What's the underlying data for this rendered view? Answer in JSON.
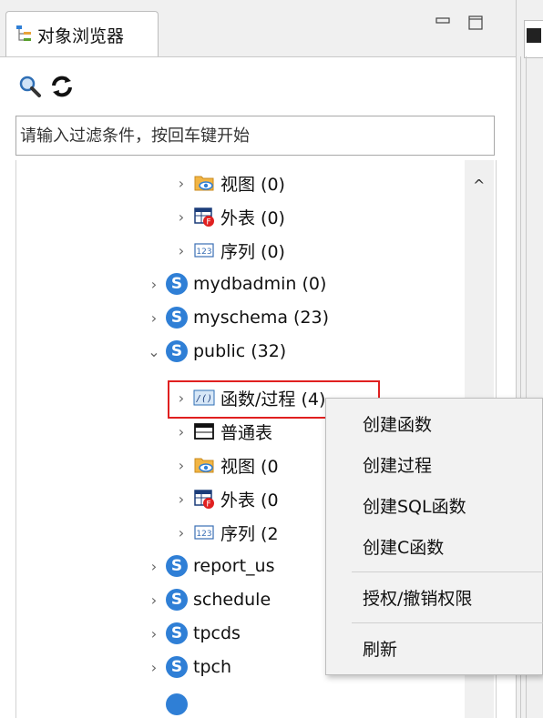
{
  "view": {
    "tab_title": "对象浏览器",
    "filter_placeholder": "请输入过滤条件，按回车键开始"
  },
  "tree": [
    {
      "label": "视图 (0)",
      "icon": "view-icon",
      "expanded": false
    },
    {
      "label": "外表 (0)",
      "icon": "foreign-table-icon",
      "expanded": false
    },
    {
      "label": "序列 (0)",
      "icon": "sequence-icon",
      "expanded": false
    },
    {
      "label": "mydbadmin (0)",
      "icon": "schema-icon",
      "expanded": false
    },
    {
      "label": "myschema (23)",
      "icon": "schema-icon",
      "expanded": false
    },
    {
      "label": "public (32)",
      "icon": "schema-icon",
      "expanded": true
    },
    {
      "label": "函数/过程 (4)",
      "icon": "function-folder-icon",
      "expanded": false
    },
    {
      "label": "普通表",
      "icon": "table-icon",
      "expanded": false
    },
    {
      "label": "视图 (0",
      "icon": "view-icon",
      "expanded": false
    },
    {
      "label": "外表 (0",
      "icon": "foreign-table-icon",
      "expanded": false
    },
    {
      "label": "序列 (2",
      "icon": "sequence-icon",
      "expanded": false
    },
    {
      "label": "report_us",
      "icon": "schema-icon",
      "expanded": false
    },
    {
      "label": "schedule",
      "icon": "schema-icon",
      "expanded": false
    },
    {
      "label": "tpcds",
      "icon": "schema-icon",
      "expanded": false
    },
    {
      "label": "tpch",
      "icon": "schema-icon",
      "expanded": false
    }
  ],
  "schema_letter": "S",
  "context_menu": [
    "创建函数",
    "创建过程",
    "创建SQL函数",
    "创建C函数",
    "授权/撤销权限",
    "刷新"
  ],
  "colors": {
    "highlight": "#e02020",
    "schema": "#2f7fd6"
  }
}
